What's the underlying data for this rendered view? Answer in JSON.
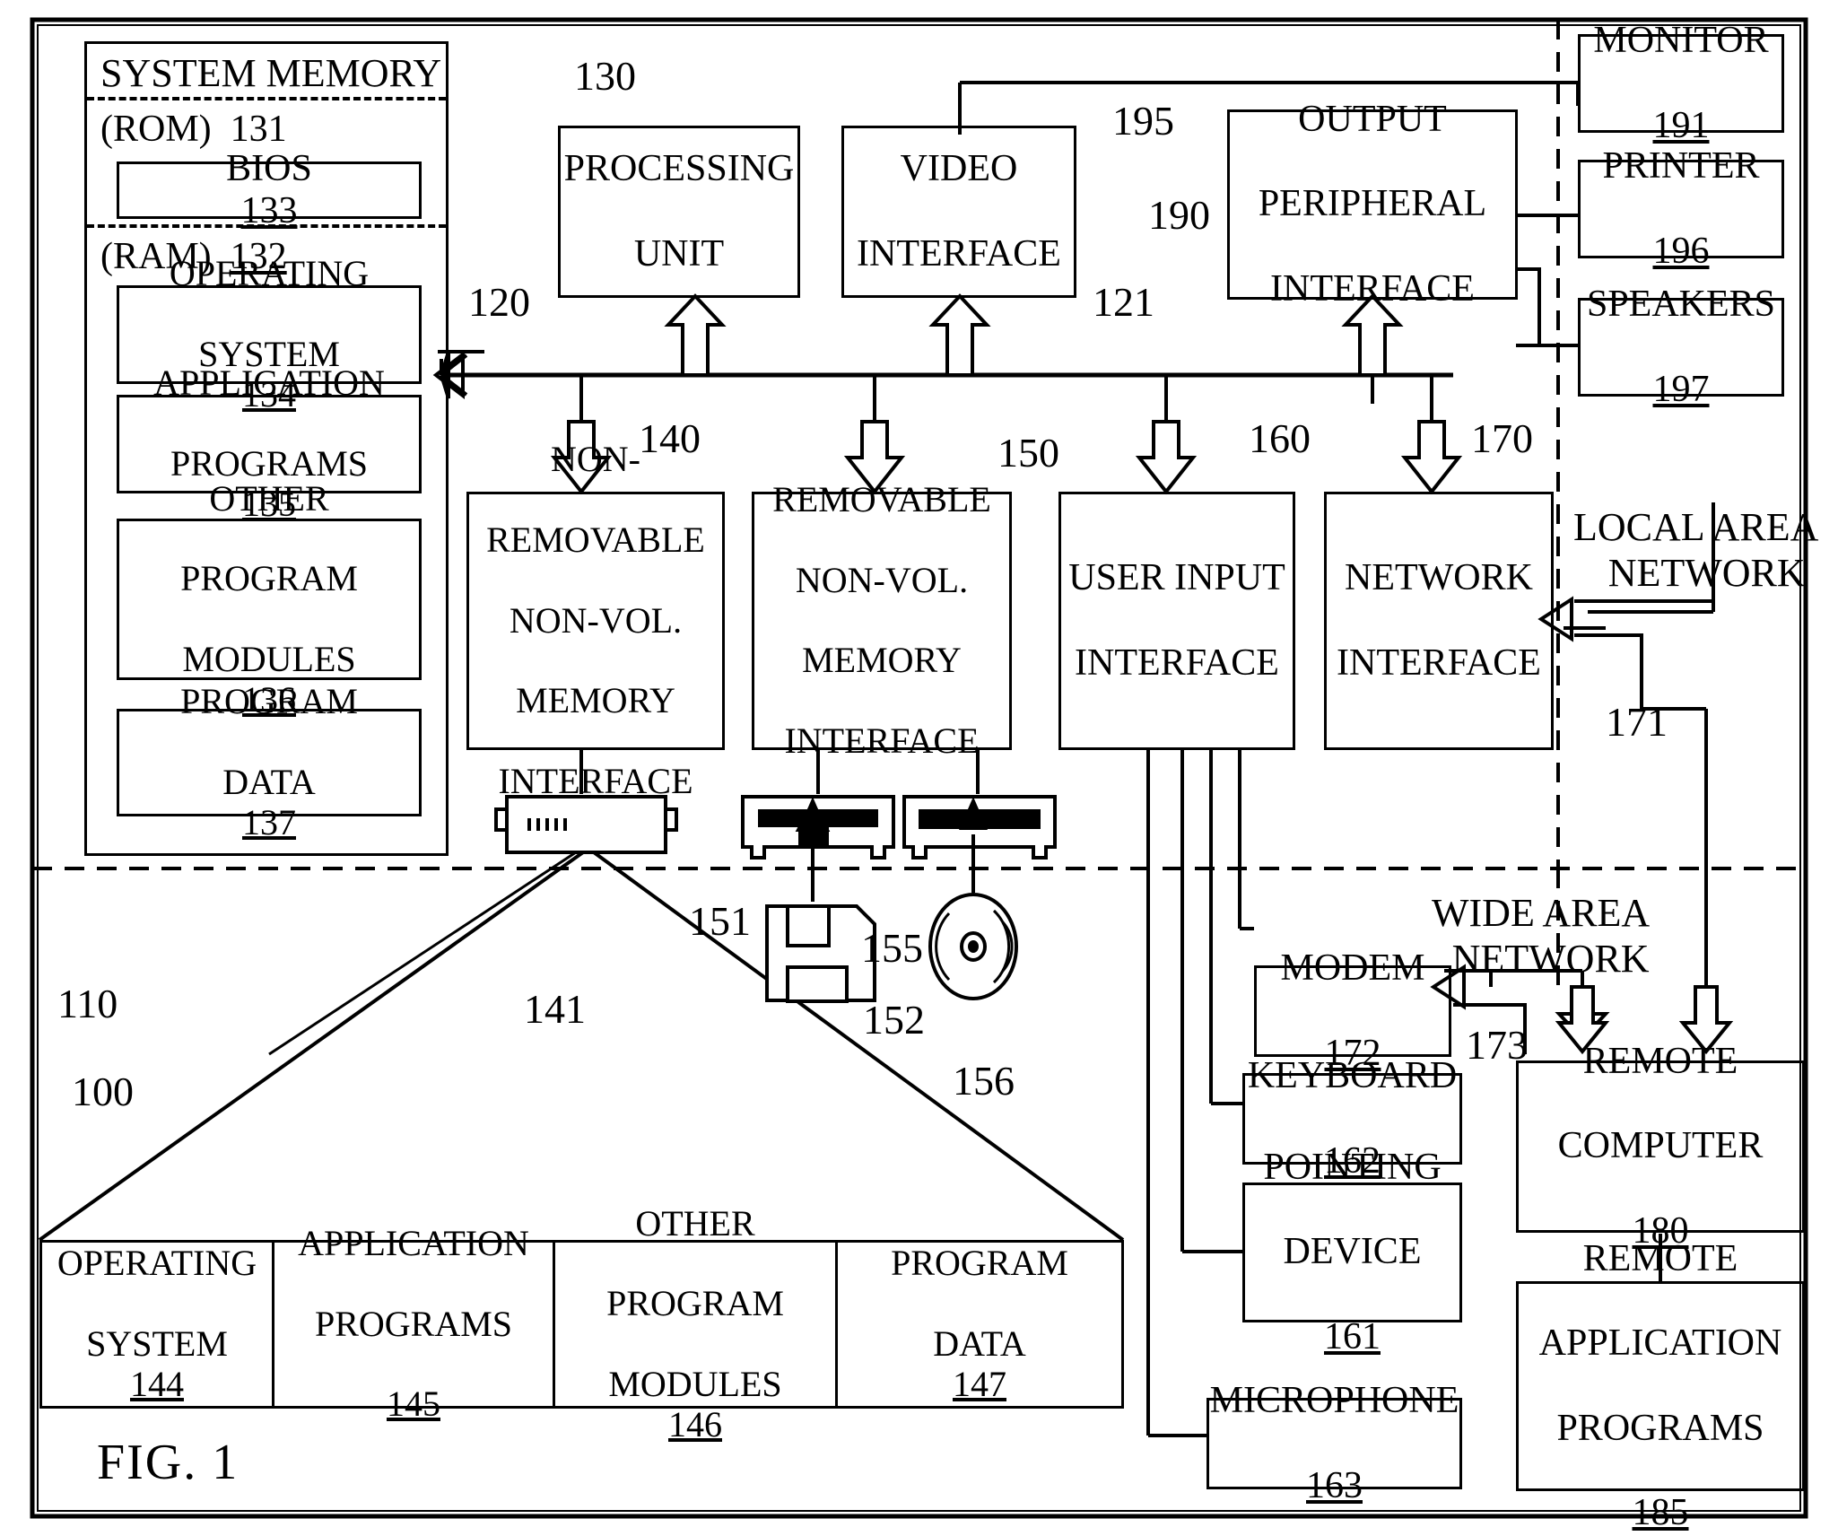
{
  "figure": {
    "caption": "FIG. 1",
    "outer_ref": "100",
    "computer_ref": "110"
  },
  "system_memory": {
    "title": "SYSTEM MEMORY",
    "ref": "130",
    "rom_label": "(ROM)",
    "rom_ref": "131",
    "bios_label": "BIOS",
    "bios_ref": "133",
    "ram_label": "(RAM)",
    "ram_ref": "132",
    "items": [
      {
        "line1": "OPERATING",
        "line2": "SYSTEM",
        "ref": "134"
      },
      {
        "line1": "APPLICATION",
        "line2": "PROGRAMS",
        "ref": "135"
      },
      {
        "line1": "OTHER",
        "line2": "PROGRAM",
        "line3": "MODULES",
        "ref": "136"
      },
      {
        "line1": "PROGRAM",
        "line2": "DATA",
        "ref": "137"
      }
    ]
  },
  "top_row": {
    "processing_unit": {
      "line1": "PROCESSING",
      "line2": "UNIT",
      "ref": "120"
    },
    "video_interface": {
      "line1": "VIDEO",
      "line2": "INTERFACE",
      "ref": "190"
    },
    "output_peripheral_interface": {
      "line1": "OUTPUT",
      "line2": "PERIPHERAL",
      "line3": "INTERFACE",
      "ref": "195"
    },
    "bus_ref": "121"
  },
  "output_devices": [
    {
      "label": "MONITOR",
      "ref": "191"
    },
    {
      "label": "PRINTER",
      "ref": "196"
    },
    {
      "label": "SPEAKERS",
      "ref": "197"
    }
  ],
  "interface_row": {
    "non_removable": {
      "line1": "NON-",
      "line2": "REMOVABLE",
      "line3": "NON-VOL.",
      "line4": "MEMORY",
      "line5": "INTERFACE",
      "ref": "140"
    },
    "removable": {
      "line1": "REMOVABLE",
      "line2": "NON-VOL.",
      "line3": "MEMORY",
      "line4": "INTERFACE",
      "ref": "150"
    },
    "user_input": {
      "line1": "USER INPUT",
      "line2": "INTERFACE",
      "ref": "160"
    },
    "network": {
      "line1": "NETWORK",
      "line2": "INTERFACE",
      "ref": "170"
    }
  },
  "drives": {
    "hard_disk_ref": "141",
    "hard_disk_interface_ref": "151",
    "floppy_disk_ref": "152",
    "floppy_drive_ref": "155",
    "optical_disk_ref": "156"
  },
  "networks": {
    "lan": {
      "line1": "LOCAL AREA",
      "line2": "NETWORK",
      "ref": "171"
    },
    "wan": {
      "line1": "WIDE AREA",
      "line2": "NETWORK",
      "ref": "173"
    }
  },
  "peripherals": [
    {
      "label": "MODEM",
      "ref": "172"
    },
    {
      "label": "KEYBOARD",
      "ref": "162"
    },
    {
      "line1": "POINTING",
      "line2": "DEVICE",
      "ref": "161"
    },
    {
      "label": "MICROPHONE",
      "ref": "163"
    }
  ],
  "remote": {
    "computer": {
      "line1": "REMOTE",
      "line2": "COMPUTER",
      "ref": "180"
    },
    "apps": {
      "line1": "REMOTE",
      "line2": "APPLICATION",
      "line3": "PROGRAMS",
      "ref": "185"
    }
  },
  "disk_table": [
    {
      "line1": "OPERATING",
      "line2": "SYSTEM",
      "ref": "144"
    },
    {
      "line1": "APPLICATION",
      "line2": "PROGRAMS",
      "ref": "145"
    },
    {
      "line1": "OTHER",
      "line2": "PROGRAM",
      "line3": "MODULES",
      "ref": "146"
    },
    {
      "line1": "PROGRAM",
      "line2": "DATA",
      "ref": "147"
    }
  ]
}
